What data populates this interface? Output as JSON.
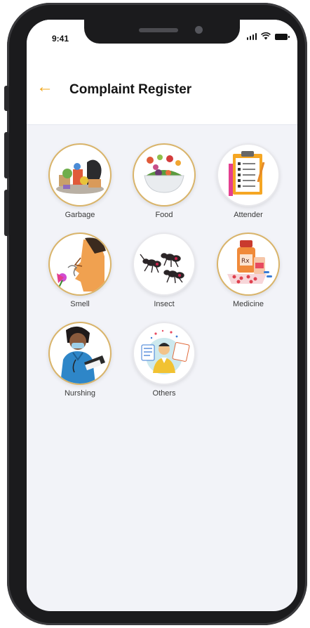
{
  "status_bar": {
    "time": "9:41"
  },
  "header": {
    "title": "Complaint Register"
  },
  "categories": [
    {
      "label": "Garbage",
      "icon": "garbage-icon"
    },
    {
      "label": "Food",
      "icon": "food-icon"
    },
    {
      "label": "Attender",
      "icon": "attender-icon"
    },
    {
      "label": "Smell",
      "icon": "smell-icon"
    },
    {
      "label": "Insect",
      "icon": "insect-icon"
    },
    {
      "label": "Medicine",
      "icon": "medicine-icon"
    },
    {
      "label": "Nurshing",
      "icon": "nursing-icon"
    },
    {
      "label": "Others",
      "icon": "others-icon"
    }
  ],
  "colors": {
    "accent": "#f2a71b",
    "background": "#f2f3f8",
    "ring": "#d9b46a"
  }
}
